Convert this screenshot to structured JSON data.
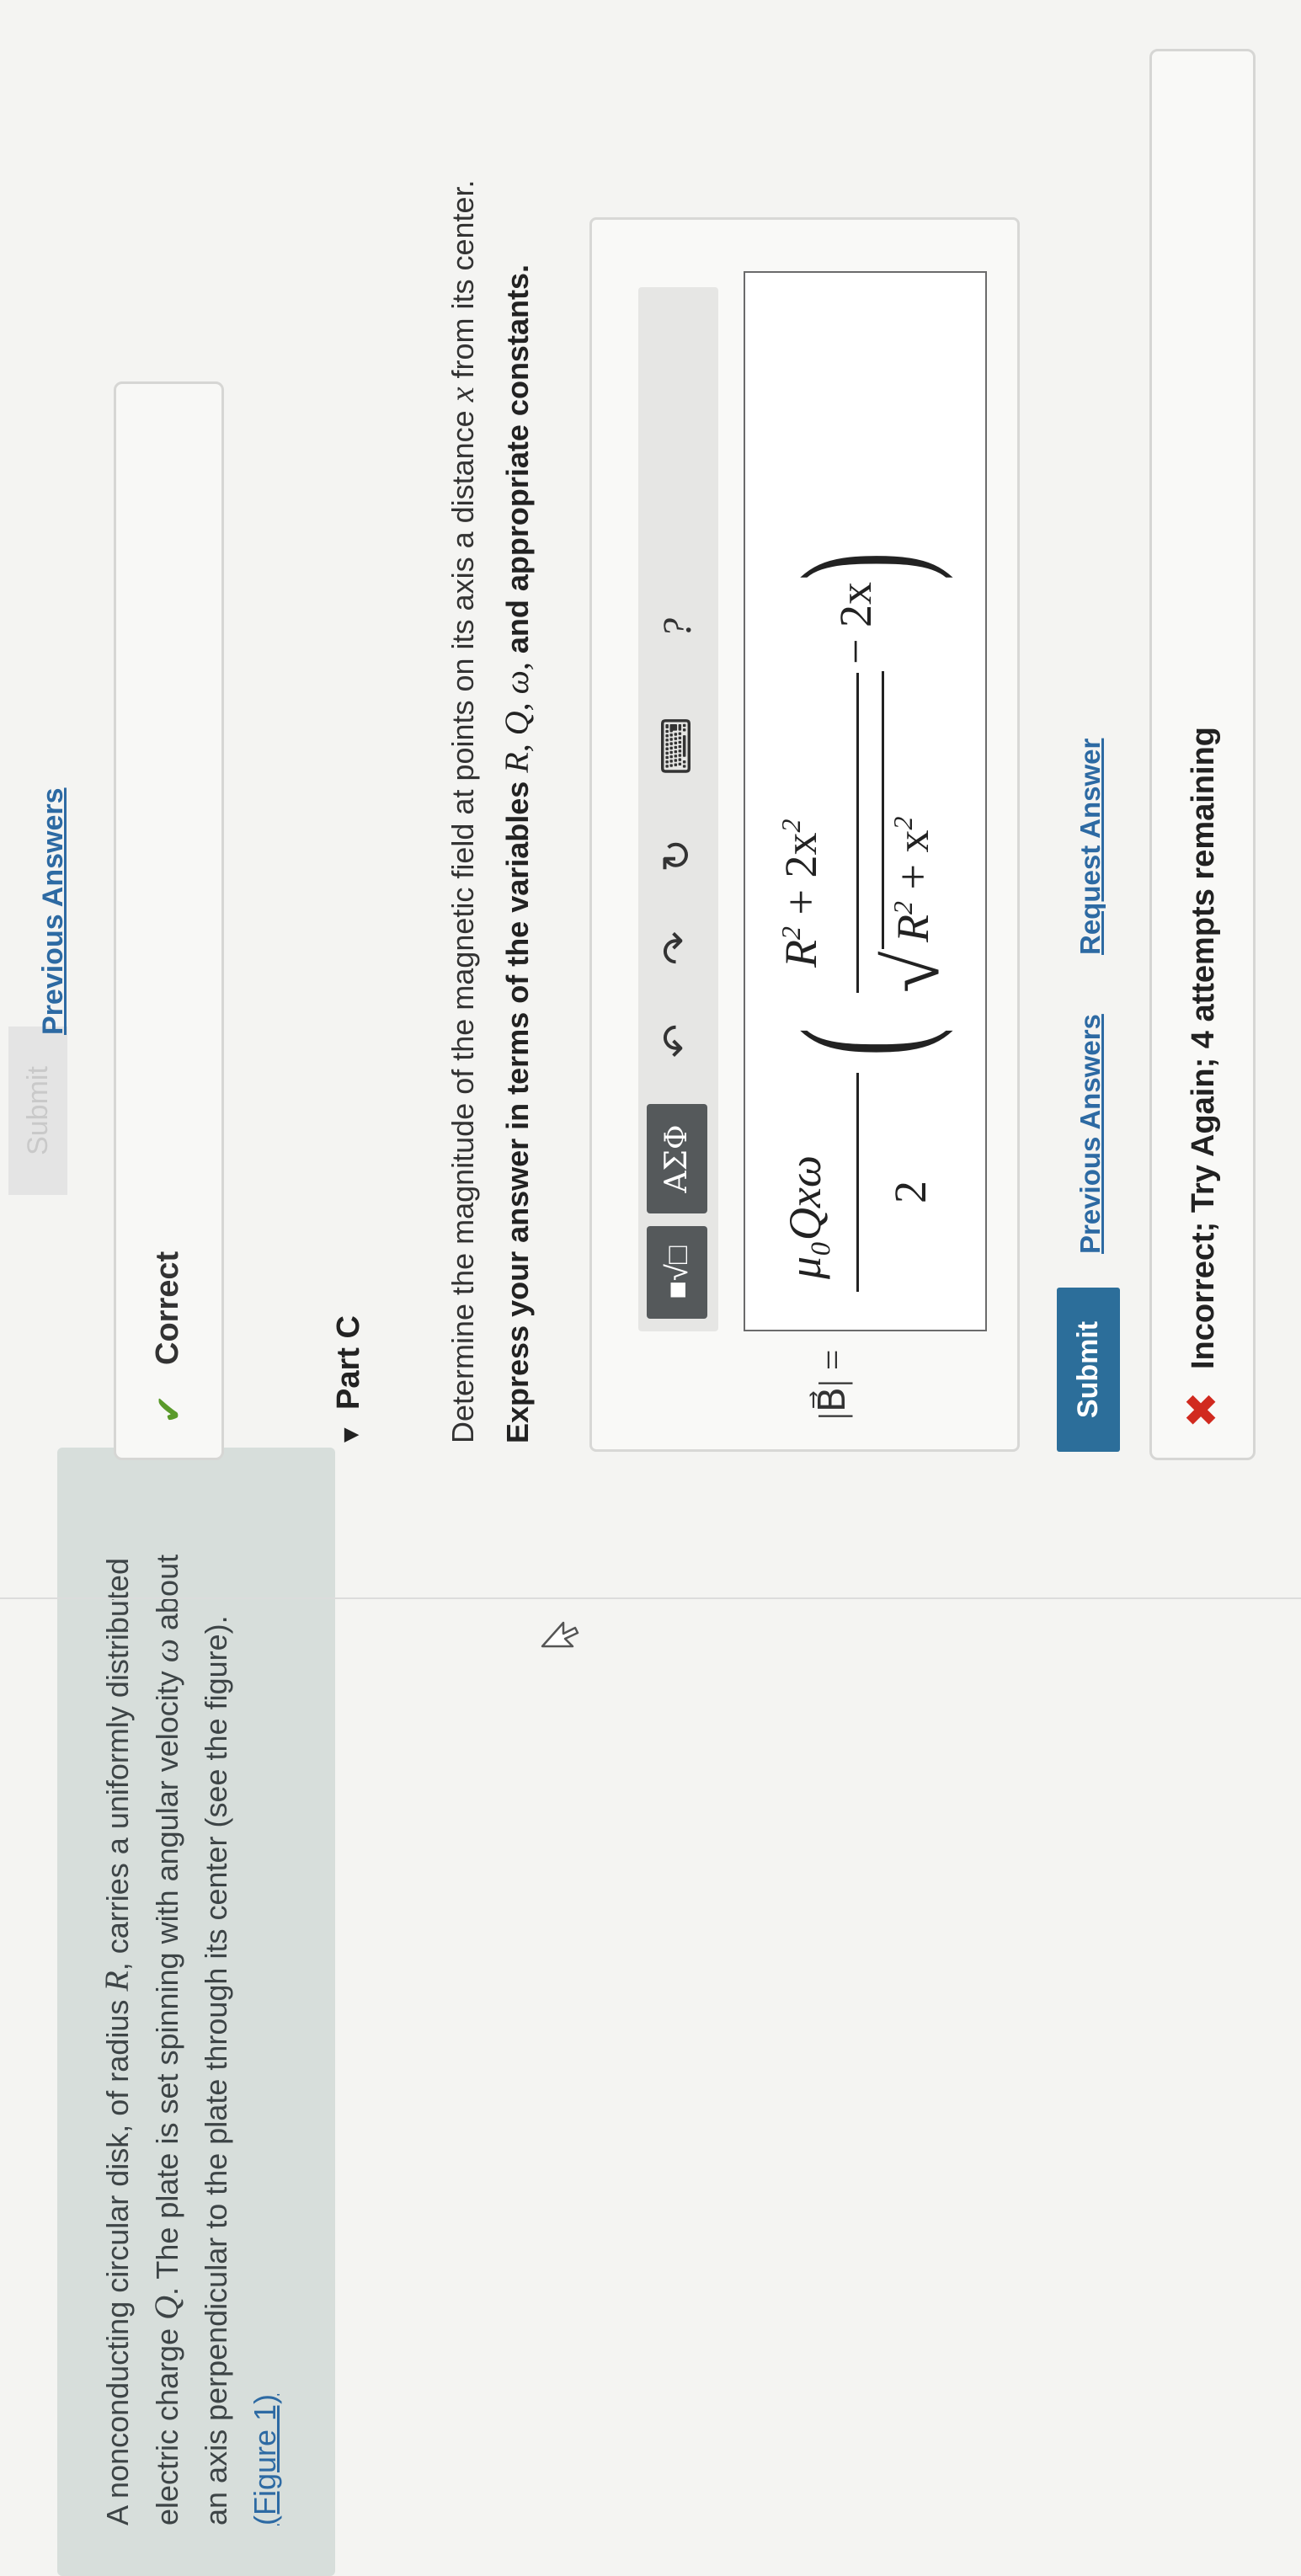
{
  "problem": {
    "text_a": "A nonconducting circular disk, of radius ",
    "var_R": "R",
    "text_b": ", carries a uniformly distributed electric charge ",
    "var_Q": "Q",
    "text_c": ". The plate is set spinning with angular velocity ",
    "var_omega": "ω",
    "text_d": " about an axis perpendicular to the plate through its center (see the figure).",
    "figure_link": "(Figure 1)"
  },
  "previous_part": {
    "submit_label": "Submit",
    "previous_answers_label": "Previous Answers",
    "feedback_label": "Correct"
  },
  "part_c": {
    "title": "Part C",
    "prompt_a": "Determine the magnitude of the magnetic field at points on its axis a distance ",
    "prompt_x": "x",
    "prompt_b": " from its center.",
    "instruction_a": "Express your answer in terms of the variables ",
    "instruction_vars": "R, Q, ω,",
    "instruction_b": " and appropriate constants."
  },
  "toolbar": {
    "templates": "■√□",
    "symbols": "ΑΣΦ",
    "help": "?"
  },
  "answer": {
    "lhs": "|B⃗| =",
    "num1": "μ₀Qxω",
    "den1": "2",
    "num2_a": "R",
    "num2_b": " + 2x",
    "den2_a": "R",
    "den2_b": " + x",
    "sq": "2",
    "tail": "− 2x"
  },
  "actions": {
    "submit_label": "Submit",
    "previous_answers_label": "Previous Answers",
    "request_answer_label": "Request Answer"
  },
  "feedback": {
    "message": "Incorrect; Try Again; 4 attempts remaining"
  },
  "colors": {
    "link": "#2d6aa3",
    "submit_bg": "#2c6e9a",
    "correct": "#5a9a2a",
    "incorrect": "#d12a1f",
    "intro_panel": "#d7dedb"
  }
}
